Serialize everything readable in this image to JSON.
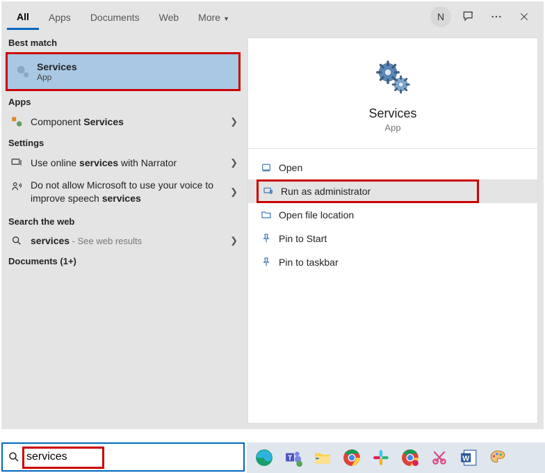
{
  "tabs": {
    "all": "All",
    "apps": "Apps",
    "documents": "Documents",
    "web": "Web",
    "more": "More"
  },
  "header": {
    "avatar_initial": "N"
  },
  "left": {
    "best_match_label": "Best match",
    "best": {
      "title": "Services",
      "subtitle": "App"
    },
    "apps_label": "Apps",
    "apps_item_prefix": "Component ",
    "apps_item_bold": "Services",
    "settings_label": "Settings",
    "setting1_pre": "Use online ",
    "setting1_bold": "services",
    "setting1_post": " with Narrator",
    "setting2_pre": "Do not allow Microsoft to use your voice to improve speech ",
    "setting2_bold": "services",
    "search_web_label": "Search the web",
    "web_item_bold": "services",
    "web_item_suffix": " - See web results",
    "documents_label": "Documents (1+)"
  },
  "preview": {
    "title": "Services",
    "subtitle": "App"
  },
  "actions": {
    "open": "Open",
    "run_admin": "Run as administrator",
    "open_loc": "Open file location",
    "pin_start": "Pin to Start",
    "pin_taskbar": "Pin to taskbar"
  },
  "search": {
    "value": "services"
  }
}
